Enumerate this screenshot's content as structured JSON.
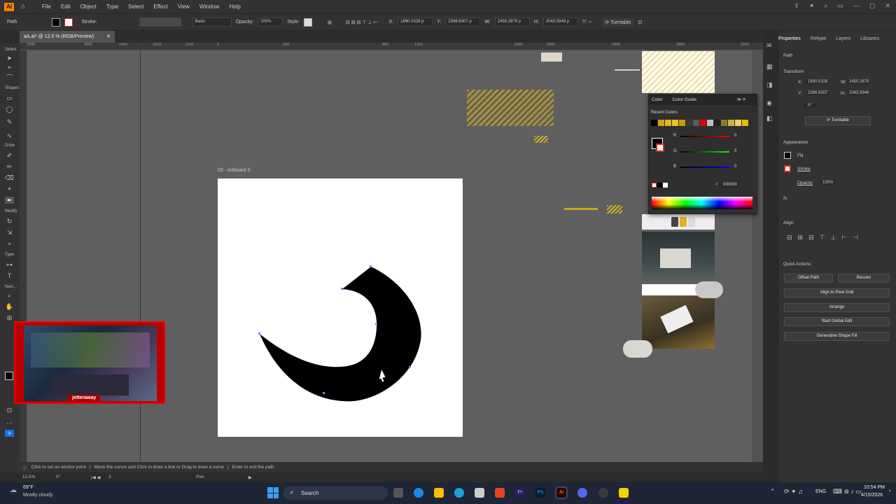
{
  "menubar": {
    "logo": "Ai",
    "items": [
      "File",
      "Edit",
      "Object",
      "Type",
      "Select",
      "Effect",
      "View",
      "Window",
      "Help"
    ]
  },
  "control_bar": {
    "selection_type": "Path",
    "stroke_label": "Stroke:",
    "brush_label": "Basic",
    "opacity_label": "Opacity:",
    "opacity_value": "100%",
    "style_label": "Style:",
    "x_label": "X:",
    "x_value": "1890.0328 p",
    "y_label": "Y:",
    "y_value": "2386.6307 p",
    "w_label": "W:",
    "w_value": "2450.2879 p",
    "h_label": "H:",
    "h_value": "2042.5948 p",
    "turntable_label": "Turntable"
  },
  "document": {
    "tab_title": "aA.ai* @ 12.5 % (RGB/Preview)",
    "artboard_label": "03 - Artboard 3"
  },
  "ruler": {
    "h_ticks": [
      "3200",
      "2800",
      "2400",
      "1600",
      "1200",
      "800",
      "0",
      "400",
      "800",
      "1200",
      "1600",
      "2000",
      "2400",
      "2800",
      "3200"
    ]
  },
  "tools_groups": [
    "Select",
    "Draw",
    "Modify",
    "Type",
    "Navi..."
  ],
  "status": {
    "hint1": "Click to set an anchor point",
    "hint2": "Move the cursor and Click to draw a line or Drag to draw a curve",
    "hint3": "Enter to exit the path",
    "zoom": "12.5%",
    "rotation": "0°",
    "artboard_num": "3",
    "tool_name": "Pen"
  },
  "color_panel": {
    "tabs": [
      "Color",
      "Color Guide"
    ],
    "recent_label": "Recent Colors",
    "r_label": "R",
    "g_label": "G",
    "b_label": "B",
    "r_value": "0",
    "g_value": "0",
    "b_value": "0",
    "hex": "000000",
    "recent_colors": [
      "#000000",
      "#d4a017",
      "#e6b422",
      "#f0c020",
      "#c8a000",
      "#3a3a3a",
      "#5a5a5a",
      "#e00000",
      "#c0c0c0",
      "#202020",
      "#8a7a3a",
      "#d4b040",
      "#f0d060",
      "#e0c000"
    ]
  },
  "right_panel": {
    "tabs": [
      "Properties",
      "Refype",
      "Layers",
      "Libraries"
    ],
    "selection": "Path",
    "transform_label": "Transform",
    "x_label": "X:",
    "x_value": "1890.0328",
    "y_label": "Y:",
    "y_value": "2386.6307",
    "w_label": "W:",
    "w_value": "2450.2879",
    "h_label": "H:",
    "h_value": "2042.5948",
    "angle_value": "0°",
    "turntable_label": "Turntable",
    "appearance_label": "Appearance",
    "fill_label": "Fill",
    "stroke_label": "Stroke",
    "opacity_label": "Opacity",
    "opacity_value": "100%",
    "fx_label": "fx.",
    "align_label": "Align",
    "quick_actions_label": "Quick Actions",
    "offset_path": "Offset Path",
    "recolor": "Recolor",
    "align_pixel": "Align to Pixel Grid",
    "arrange": "Arrange",
    "start_global_edit": "Start Global Edit",
    "generative_shape_fill": "Generative Shape Fill"
  },
  "webcam": {
    "name_label": "jetteraway"
  },
  "taskbar": {
    "weather_temp": "69°F",
    "weather_desc": "Mostly cloudy",
    "search_label": "Search",
    "lang": "ENG",
    "time": "10:54 PM",
    "date": "4/15/2026"
  }
}
